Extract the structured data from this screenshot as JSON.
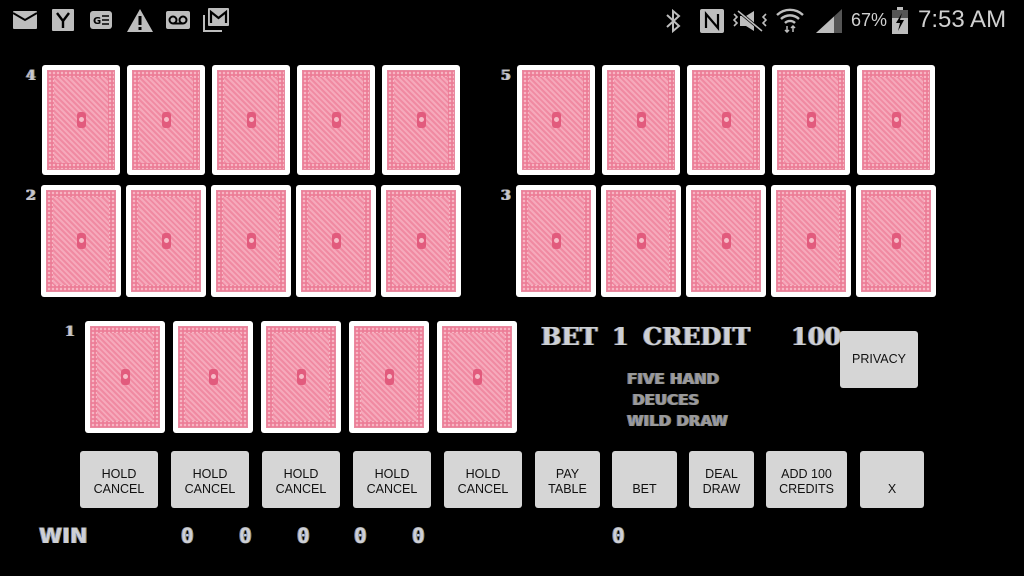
{
  "status_bar": {
    "left_icons": [
      "mail-icon",
      "yahoo-icon",
      "ge-icon",
      "warning-icon",
      "voicemail-icon",
      "gmail-icon"
    ],
    "right_icons": [
      "bluetooth-icon",
      "nfc-icon",
      "vibrate-mute-icon",
      "wifi-icon",
      "signal-icon",
      "battery-charging-icon"
    ],
    "battery": "67%",
    "time": "7:53 AM"
  },
  "hands": [
    {
      "label": "4",
      "cards": [
        "card-back",
        "card-back",
        "card-back",
        "card-back",
        "card-back"
      ]
    },
    {
      "label": "5",
      "cards": [
        "card-back",
        "card-back",
        "card-back",
        "card-back",
        "card-back"
      ]
    },
    {
      "label": "2",
      "cards": [
        "card-back",
        "card-back",
        "card-back",
        "card-back",
        "card-back"
      ]
    },
    {
      "label": "3",
      "cards": [
        "card-back",
        "card-back",
        "card-back",
        "card-back",
        "card-back"
      ]
    },
    {
      "label": "1",
      "cards": [
        "card-back",
        "card-back",
        "card-back",
        "card-back",
        "card-back"
      ]
    }
  ],
  "info": {
    "bet_label": "BET",
    "bet_value": "1",
    "credit_label": "CREDIT",
    "credit_value": "100",
    "game_title_lines": [
      "FIVE HAND",
      " DEUCES",
      "WILD DRAW"
    ],
    "privacy_button": "PRIVACY"
  },
  "buttons": [
    {
      "line1": "HOLD",
      "line2": "CANCEL"
    },
    {
      "line1": "HOLD",
      "line2": "CANCEL"
    },
    {
      "line1": "HOLD",
      "line2": "CANCEL"
    },
    {
      "line1": "HOLD",
      "line2": "CANCEL"
    },
    {
      "line1": "HOLD",
      "line2": "CANCEL"
    },
    {
      "line1": "PAY",
      "line2": "TABLE"
    },
    {
      "line1": "",
      "line2": "BET"
    },
    {
      "line1": "DEAL",
      "line2": "DRAW"
    },
    {
      "line1": "ADD 100",
      "line2": "CREDITS"
    },
    {
      "line1": "",
      "line2": "X"
    }
  ],
  "win_row": {
    "label": "WIN",
    "hand_wins": [
      "0",
      "0",
      "0",
      "0",
      "0"
    ],
    "total_win": "0"
  }
}
